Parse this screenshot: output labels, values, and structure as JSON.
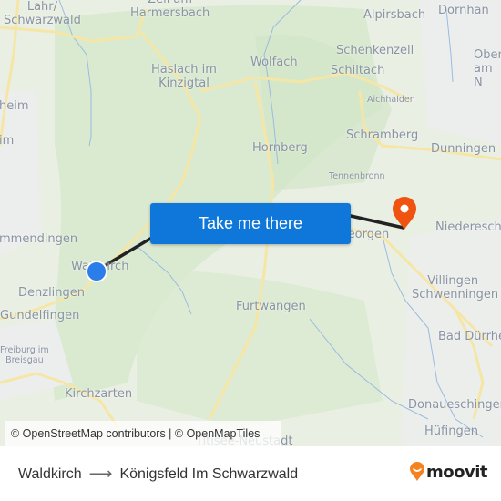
{
  "map": {
    "places": [
      {
        "name": "Lahr/\nSchwarzwald",
        "size": "normal"
      },
      {
        "name": "Zell am\nHarmersbach",
        "size": "normal"
      },
      {
        "name": "Haslach im\nKinzigtal",
        "size": "normal"
      },
      {
        "name": "Wolfach",
        "size": "normal"
      },
      {
        "name": "Alpirsbach",
        "size": "normal"
      },
      {
        "name": "Dornhan",
        "size": "normal"
      },
      {
        "name": "Schenkenzell",
        "size": "normal"
      },
      {
        "name": "Schiltach",
        "size": "normal"
      },
      {
        "name": "Ober\nam N",
        "size": "normal"
      },
      {
        "name": "Aichhalden",
        "size": "small"
      },
      {
        "name": "heim",
        "size": "normal"
      },
      {
        "name": "im",
        "size": "normal"
      },
      {
        "name": "Hornberg",
        "size": "normal"
      },
      {
        "name": "Schramberg",
        "size": "normal"
      },
      {
        "name": "Dunningen",
        "size": "normal"
      },
      {
        "name": "Tennenbronn",
        "size": "small"
      },
      {
        "name": "mmendingen",
        "size": "normal"
      },
      {
        "name": "Waldkirch",
        "size": "normal"
      },
      {
        "name": "St. Georgen",
        "size": "normal"
      },
      {
        "name": "Niedereschach",
        "size": "normal"
      },
      {
        "name": "Denzlingen",
        "size": "normal"
      },
      {
        "name": "Gundelfingen",
        "size": "normal"
      },
      {
        "name": "Villingen-\nSchwenningen",
        "size": "normal"
      },
      {
        "name": "Furtwangen",
        "size": "normal"
      },
      {
        "name": "Bad Dürrheim",
        "size": "normal"
      },
      {
        "name": "Freiburg im\nBreisgau",
        "size": "small"
      },
      {
        "name": "Kirchzarten",
        "size": "normal"
      },
      {
        "name": "Donaueschingen",
        "size": "normal"
      },
      {
        "name": "Hüfingen",
        "size": "normal"
      },
      {
        "name": "Titisee-Neustadt",
        "size": "normal"
      }
    ],
    "origin_marker": {
      "label": "Waldkirch",
      "color": "#2b7de9"
    },
    "destination_marker": {
      "label": "Königsfeld Im Schwarzwald",
      "color": "#f0530f"
    },
    "route_line_color": "#222222"
  },
  "cta": {
    "label": "Take me there",
    "color": "#0f77d9"
  },
  "attribution": "© OpenStreetMap contributors | © OpenMapTiles",
  "footer": {
    "from": "Waldkirch",
    "arrow": "⟶",
    "to": "Königsfeld Im Schwarzwald",
    "brand": "moovit",
    "brand_color": "#f58220"
  }
}
